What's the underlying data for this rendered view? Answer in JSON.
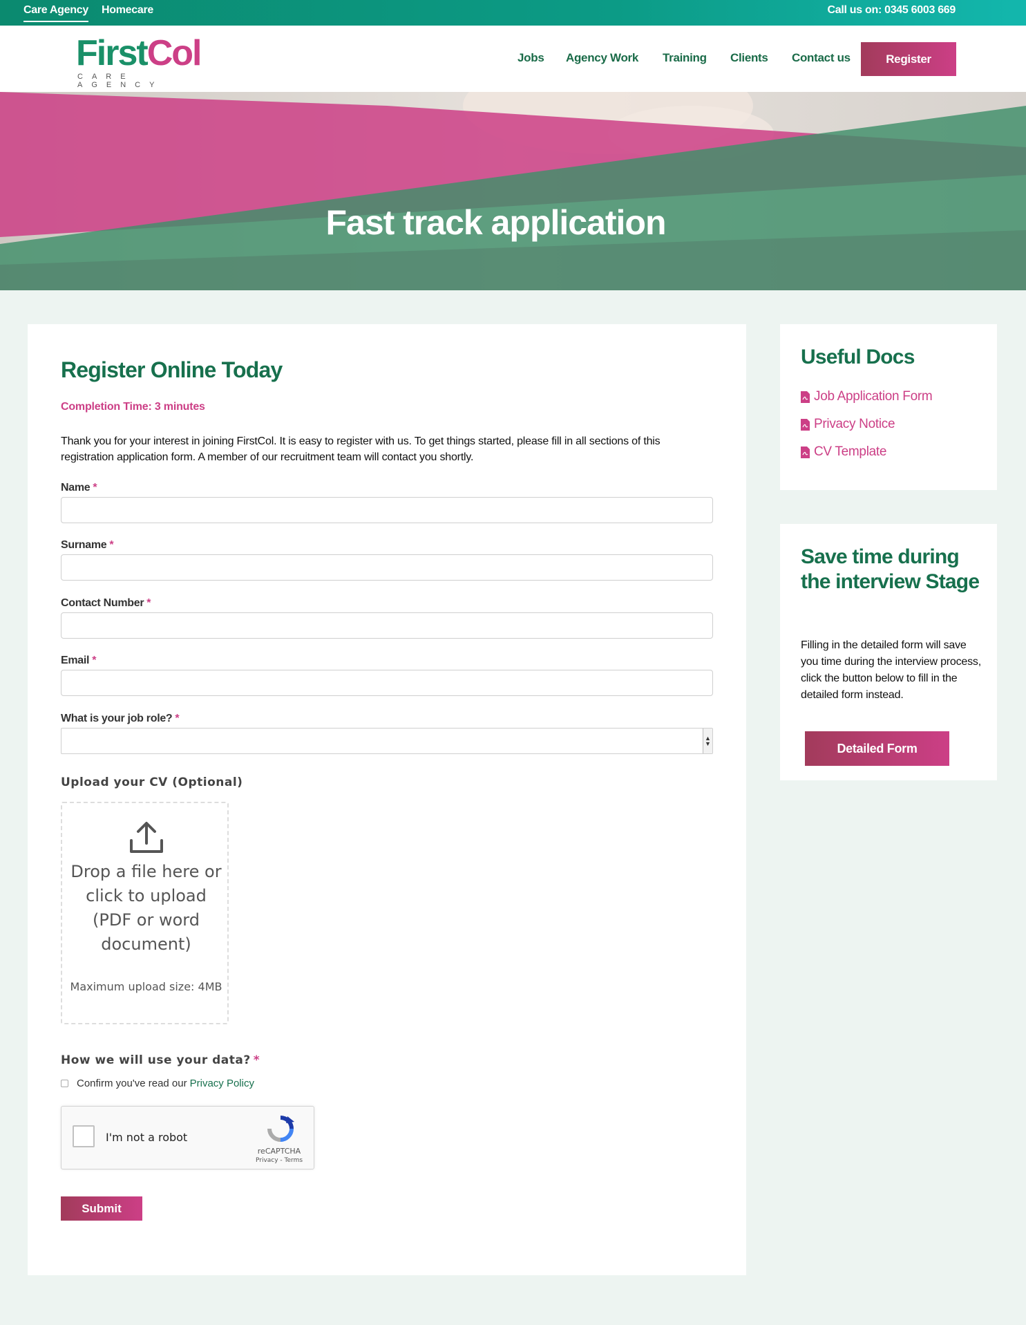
{
  "topbar": {
    "links": [
      "Care Agency",
      "Homecare"
    ],
    "phone": "Call us on: 0345 6003 669"
  },
  "header": {
    "logo_first": "First",
    "logo_col": "Col",
    "logo_sub": "CARE AGENCY",
    "nav": [
      "Jobs",
      "Agency Work",
      "Training",
      "Clients",
      "Contact us"
    ],
    "register": "Register"
  },
  "hero": {
    "title": "Fast track application"
  },
  "form": {
    "title": "Register Online Today",
    "completion": "Completion Time: 3 minutes",
    "intro": "Thank you for your interest in joining FirstCol. It is easy to register with us. To get things started, please fill in all sections of this registration application form. A member of our recruitment team will contact you shortly.",
    "fields": {
      "name": "Name",
      "surname": "Surname",
      "contact": "Contact Number",
      "email": "Email",
      "job_role": "What is your job role?"
    },
    "required_mark": "*",
    "upload_label": "Upload your CV (Optional)",
    "drop_text": "Drop a file here or click to upload (PDF or word document)",
    "max_size": "Maximum upload size: 4MB",
    "data_label": "How we will use your data?",
    "confirm_text": "Confirm you've read our",
    "privacy_link": "Privacy Policy",
    "captcha_label": "I'm not a robot",
    "captcha_brand": "reCAPTCHA",
    "captcha_terms": "Privacy - Terms",
    "submit": "Submit"
  },
  "sidebar": {
    "docs_title": "Useful Docs",
    "docs": [
      "Job Application Form",
      "Privacy Notice",
      "CV Template"
    ],
    "save_title": "Save time during the interview Stage",
    "save_text": "Filling in the detailed form will save you time during the interview process, click the button below to fill in the detailed form instead.",
    "detailed_button": "Detailed Form"
  },
  "colors": {
    "brand_green": "#17704d",
    "brand_pink": "#cc3f86",
    "button_gradient_start": "#a23b5b",
    "topbar_teal": "#0c9b86"
  }
}
